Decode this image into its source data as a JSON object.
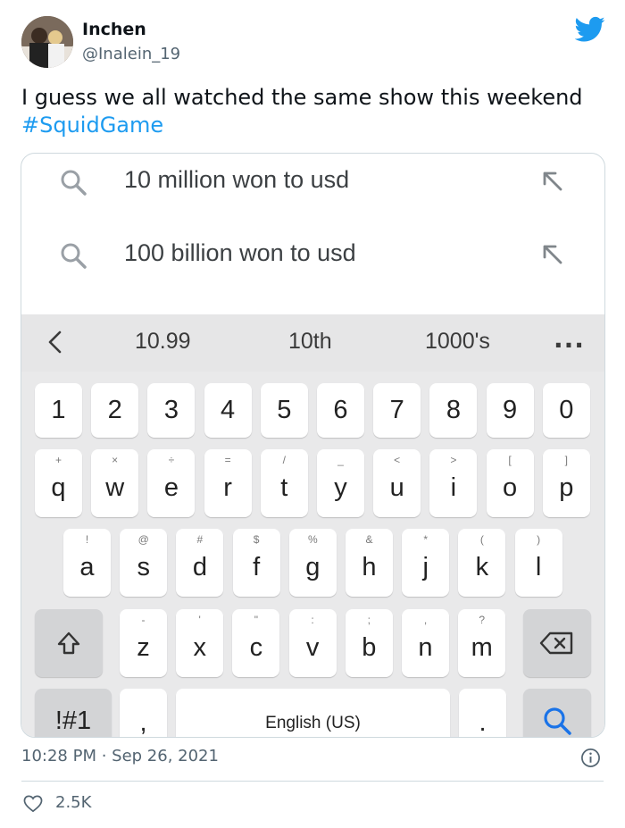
{
  "author": {
    "name": "Inchen",
    "handle": "@Inalein_19"
  },
  "tweet": {
    "text": "I guess we all watched the same show this weekend ",
    "hashtag": "#SquidGame"
  },
  "search_suggestions": [
    "10 million won to usd",
    "100 billion won to usd"
  ],
  "predictions": [
    "10.99",
    "10th",
    "1000's"
  ],
  "keyboard": {
    "number_row": [
      "1",
      "2",
      "3",
      "4",
      "5",
      "6",
      "7",
      "8",
      "9",
      "0"
    ],
    "row1": [
      {
        "key": "q",
        "sub": "+"
      },
      {
        "key": "w",
        "sub": "×"
      },
      {
        "key": "e",
        "sub": "÷"
      },
      {
        "key": "r",
        "sub": "="
      },
      {
        "key": "t",
        "sub": "/"
      },
      {
        "key": "y",
        "sub": "_"
      },
      {
        "key": "u",
        "sub": "<"
      },
      {
        "key": "i",
        "sub": ">"
      },
      {
        "key": "o",
        "sub": "["
      },
      {
        "key": "p",
        "sub": "]"
      }
    ],
    "row2": [
      {
        "key": "a",
        "sub": "!"
      },
      {
        "key": "s",
        "sub": "@"
      },
      {
        "key": "d",
        "sub": "#"
      },
      {
        "key": "f",
        "sub": "$"
      },
      {
        "key": "g",
        "sub": "%"
      },
      {
        "key": "h",
        "sub": "&"
      },
      {
        "key": "j",
        "sub": "*"
      },
      {
        "key": "k",
        "sub": "("
      },
      {
        "key": "l",
        "sub": ")"
      }
    ],
    "row3": [
      {
        "key": "z",
        "sub": "-"
      },
      {
        "key": "x",
        "sub": "'"
      },
      {
        "key": "c",
        "sub": "\""
      },
      {
        "key": "v",
        "sub": ":"
      },
      {
        "key": "b",
        "sub": ";"
      },
      {
        "key": "n",
        "sub": ","
      },
      {
        "key": "m",
        "sub": "?"
      }
    ],
    "symbols_label": "!#1",
    "comma_label": ",",
    "space_label": "English (US)",
    "period_label": "."
  },
  "footer": {
    "timestamp": "10:28 PM · Sep 26, 2021",
    "likes": "2.5K"
  },
  "colors": {
    "accent": "#1d9bf0",
    "keyboard_bg": "#e9e9ea",
    "search_blue": "#1a73e8"
  },
  "icons": [
    "twitter-bird-icon",
    "search-icon",
    "arrow-up-left-icon",
    "chevron-left-icon",
    "more-icon",
    "shift-icon",
    "backspace-icon",
    "info-icon",
    "heart-icon"
  ]
}
